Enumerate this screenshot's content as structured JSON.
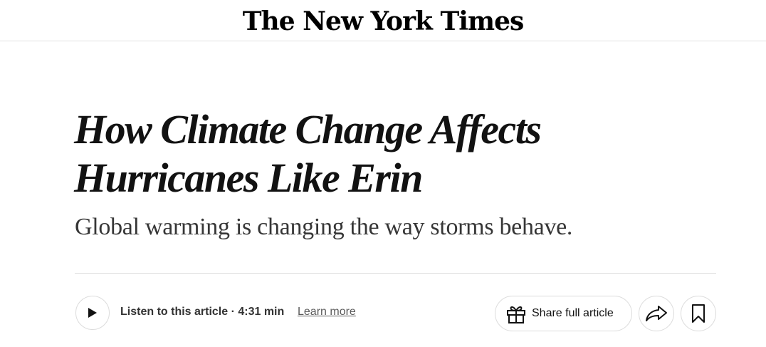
{
  "masthead": {
    "logo_text": "The New York Times"
  },
  "article": {
    "headline_line1": "How Climate Change Affects",
    "headline_line2": "Hurricanes Like Erin",
    "summary": "Global warming is changing the way storms behave."
  },
  "toolbar": {
    "listen_label": "Listen to this article · 4:31 min",
    "learn_more_label": "Learn more",
    "share_label": "Share full article",
    "icons": {
      "play": "play-icon",
      "gift": "gift-icon",
      "forward": "share-arrow-icon",
      "save": "bookmark-icon"
    }
  },
  "colors": {
    "text": "#121212",
    "summary": "#363636",
    "border": "#dcdcdc",
    "link": "#5a5a5a"
  }
}
